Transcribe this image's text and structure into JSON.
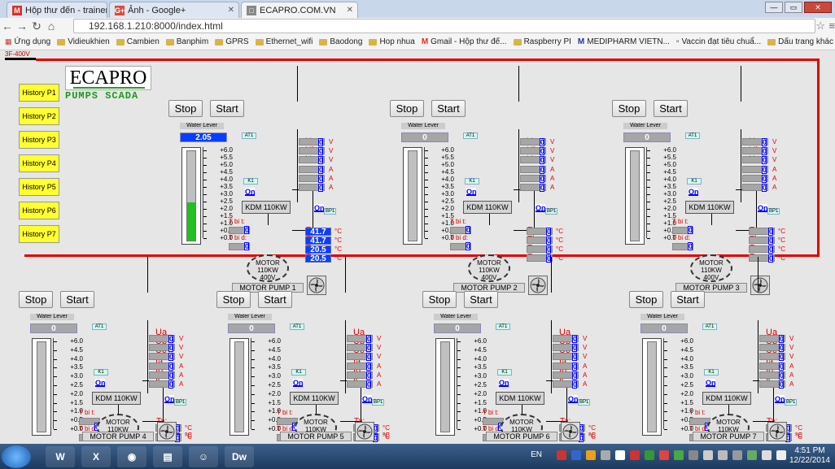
{
  "browser": {
    "tabs": [
      {
        "label": "Hộp thư đến - trainer.ecap",
        "icon_text": "M",
        "icon_color": "#d93025"
      },
      {
        "label": "Ảnh - Google+",
        "icon_text": "G+",
        "icon_color": "#dd4b39"
      },
      {
        "label": "ECAPRO.COM.VN",
        "icon_text": "□",
        "icon_color": "#666666"
      }
    ],
    "url": "192.168.1.210:8000/index.html",
    "bookmarks": [
      "Ứng dụng",
      "Vidieukhien",
      "Cambien",
      "Banphim",
      "GPRS",
      "Ethernet_wifi",
      "Baodong",
      "Hop nhua",
      "Gmail - Hộp thư đế...",
      "Raspberry PI",
      "MEDIPHARM VIETN...",
      "Vaccin đạt tiêu chuẩ...",
      "Dấu trang khác"
    ]
  },
  "scada": {
    "badge": "3F-400V",
    "logo": "ECAPRO",
    "title": "PUMPS SCADA",
    "history": [
      "History P1",
      "History P2",
      "History P3",
      "History P4",
      "History P5",
      "History P6",
      "History P7"
    ],
    "labels": {
      "stop": "Stop",
      "start": "Start",
      "water_level": "Water Lever",
      "at1": "AT1",
      "k1": "K1",
      "bp1": "BP1",
      "kdm": "KDM 110KW",
      "on": "On",
      "tbit": "T bi t:",
      "tbid": "T bi d:",
      "motor_line1": "MOTOR",
      "motor_line2": "110KW",
      "motor_line3": "400V",
      "volt": [
        "Ua",
        "Ub",
        "Uc"
      ],
      "amp": [
        "Ia :",
        "Ib :",
        "Ic :"
      ],
      "temp": [
        "Ta:",
        "Tb:",
        "Tc:",
        "Tp:"
      ],
      "unit_v": "V",
      "unit_a": "A",
      "unit_c": "°C"
    },
    "scale_ticks": [
      "+6.0",
      "+5.5",
      "+5.0",
      "+4.5",
      "+4.0",
      "+3.5",
      "+3.0",
      "+2.5",
      "+2.0",
      "+1.5",
      "+1.0",
      "+0.5",
      "+0.0"
    ],
    "scale_ticks_b": [
      "+6.0",
      "+4.5",
      "+4.0",
      "+3.5",
      "+3.0",
      "+2.5",
      "+2.0",
      "+1.5",
      "+1.0",
      "+0.5",
      "+0.0"
    ],
    "pumps": [
      {
        "name": "MOTOR PUMP 1",
        "water_level": "2.05",
        "fill": 0.43,
        "voltages": [
          "0",
          "0",
          "0"
        ],
        "currents": [
          "0",
          "0",
          "0"
        ],
        "tbit": "0",
        "tbid": "0",
        "temps": [
          "41.7",
          "41.7",
          "20.5",
          "20.5"
        ],
        "temps_active": true
      },
      {
        "name": "MOTOR PUMP 2",
        "water_level": "0",
        "fill": 0,
        "voltages": [
          "0",
          "0",
          "0"
        ],
        "currents": [
          "0",
          "0",
          "0"
        ],
        "tbit": "0",
        "tbid": "0",
        "temps": [
          "0",
          "0",
          "0",
          "0"
        ],
        "temps_active": false
      },
      {
        "name": "MOTOR PUMP 3",
        "water_level": "0",
        "fill": 0,
        "voltages": [
          "0",
          "0",
          "0"
        ],
        "currents": [
          "0",
          "0",
          "0"
        ],
        "tbit": "0",
        "tbid": "0",
        "temps": [
          "0",
          "0",
          "0",
          "0"
        ],
        "temps_active": false
      },
      {
        "name": "MOTOR PUMP 4",
        "water_level": "0",
        "fill": 0,
        "voltages": [
          "0",
          "0",
          "0"
        ],
        "currents": [
          "0",
          "0",
          "0"
        ],
        "tbit": "0",
        "tbid": "0",
        "temps": [
          "0",
          "0",
          "0",
          "0"
        ],
        "temps_active": false
      },
      {
        "name": "MOTOR PUMP 5",
        "water_level": "0",
        "fill": 0,
        "voltages": [
          "0",
          "0",
          "0"
        ],
        "currents": [
          "0",
          "0",
          "0"
        ],
        "tbit": "0",
        "tbid": "0",
        "temps": [
          "0",
          "0",
          "0",
          "0"
        ],
        "temps_active": false
      },
      {
        "name": "MOTOR PUMP 6",
        "water_level": "0",
        "fill": 0,
        "voltages": [
          "0",
          "0",
          "0"
        ],
        "currents": [
          "0",
          "0",
          "0"
        ],
        "tbit": "0",
        "tbid": "0",
        "temps": [
          "0",
          "0",
          "0",
          "0"
        ],
        "temps_active": false
      },
      {
        "name": "MOTOR PUMP 7",
        "water_level": "0",
        "fill": 0,
        "voltages": [
          "0",
          "0",
          "0"
        ],
        "currents": [
          "0",
          "0",
          "0"
        ],
        "tbit": "0",
        "tbid": "0",
        "temps": [
          "0",
          "0",
          "0",
          "0"
        ],
        "temps_active": false
      }
    ]
  },
  "taskbar": {
    "lang": "EN",
    "time": "4:51 PM",
    "date": "12/22/2014",
    "apps": [
      "W",
      "X",
      "◉",
      "▤",
      "☺",
      "Dw"
    ]
  },
  "colors": {
    "busbar": "#e00000",
    "value_blue": "#0a3eff",
    "label_red": "#dd0000",
    "history_yellow": "#ffff30"
  }
}
